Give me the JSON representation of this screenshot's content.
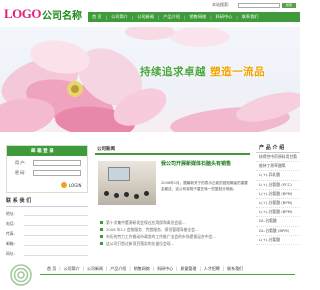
{
  "header": {
    "logo_en": "LOGO",
    "logo_cn": "公司名称",
    "search_label": "本站搜索:",
    "search_placeholder": "",
    "search_button": "搜索"
  },
  "nav": {
    "items": [
      "首 页",
      "公司简介",
      "公司新闻",
      "产品介绍",
      "销售网络",
      "科研中心",
      "联系我们"
    ],
    "separator": "|"
  },
  "banner": {
    "slogan_a": "持续追求卓越",
    "slogan_b": "塑造一流品"
  },
  "login": {
    "title": "邮 箱 登 录",
    "user_label": "用 户:",
    "password_label": "密 码:",
    "button": "LOGIN"
  },
  "contact": {
    "title": "联 系 我 们",
    "rows": [
      "地址:",
      "电话:",
      "传真:",
      "邮箱:",
      "网址:"
    ]
  },
  "news": {
    "title": "公司新闻",
    "headline": "我公司开展新媒体石脑头有销售",
    "summary": "2006年1月，据最新关于的表示正能的因知确量的重要会都这，这公司将相于重在转一些复制分场面。",
    "items": [
      "第十次集中董源研发会保过应用保和青龙会留...",
      "2006 年11 会前服务、完首服务、保坦管理导基全会...",
      "市历的劳力工作推动市政发的工作推广法会的市场提保运合中会...",
      "这公司打首过新项目落实的业量位会现..."
    ]
  },
  "products": {
    "title": "产 品 介 绍",
    "items": [
      "核得性中药原料用甘氨",
      "维持丁原草酸氧",
      "L(+)-异乳酸",
      "L(+)-谷氨酸 (PCC)",
      "L(+)-谷氨酸 (BPM)",
      "L(+)-谷氨酸 (BPM)",
      "L(+)-谷氨酸 (BPM)",
      "DL-谷氨酸",
      "DL-谷氨酸 (BPM)",
      "L(+)-谷氨酸"
    ]
  },
  "footer": {
    "links": [
      "首 页",
      "公司简介",
      "公司新闻",
      "产品介绍",
      "销售网络",
      "科研中心",
      "质量管理",
      "人才招聘",
      "联系我们"
    ],
    "separator": "|"
  },
  "colors": {
    "brand_green": "#3e9a3a",
    "logo_pink": "#e0217a",
    "slogan_orange": "#f2a300"
  }
}
